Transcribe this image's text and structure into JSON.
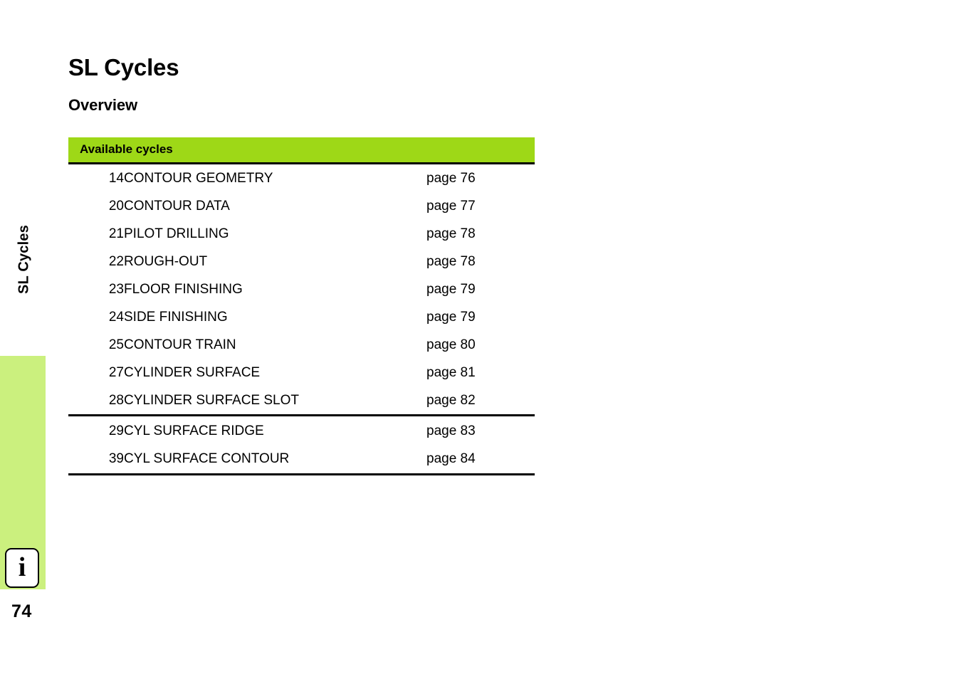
{
  "page": {
    "folio": "74",
    "running_head": "SL Cycles",
    "info_icon_glyph": "i",
    "colors": {
      "table_header_green": "#9ed817",
      "side_tab_green": "#cbf07e"
    }
  },
  "chapter": {
    "title": "SL Cycles"
  },
  "section": {
    "title": "Overview"
  },
  "table": {
    "caption": "Available cycles",
    "groups": [
      {
        "rows": [
          {
            "number": "14",
            "name": "CONTOUR GEOMETRY",
            "page_ref": "page 76"
          },
          {
            "number": "20",
            "name": "CONTOUR DATA",
            "page_ref": "page 77"
          },
          {
            "number": "21",
            "name": "PILOT DRILLING",
            "page_ref": "page 78"
          },
          {
            "number": "22",
            "name": "ROUGH-OUT",
            "page_ref": "page 78"
          },
          {
            "number": "23",
            "name": "FLOOR FINISHING",
            "page_ref": "page 79"
          },
          {
            "number": "24",
            "name": "SIDE FINISHING",
            "page_ref": "page 79"
          },
          {
            "number": "25",
            "name": "CONTOUR TRAIN",
            "page_ref": "page 80"
          },
          {
            "number": "27",
            "name": "CYLINDER SURFACE",
            "page_ref": "page 81"
          },
          {
            "number": "28",
            "name": "CYLINDER SURFACE SLOT",
            "page_ref": "page 82"
          }
        ]
      },
      {
        "rows": [
          {
            "number": "29",
            "name": "CYL SURFACE RIDGE",
            "page_ref": "page 83"
          },
          {
            "number": "39",
            "name": "CYL SURFACE CONTOUR",
            "page_ref": "page 84"
          }
        ]
      }
    ]
  }
}
